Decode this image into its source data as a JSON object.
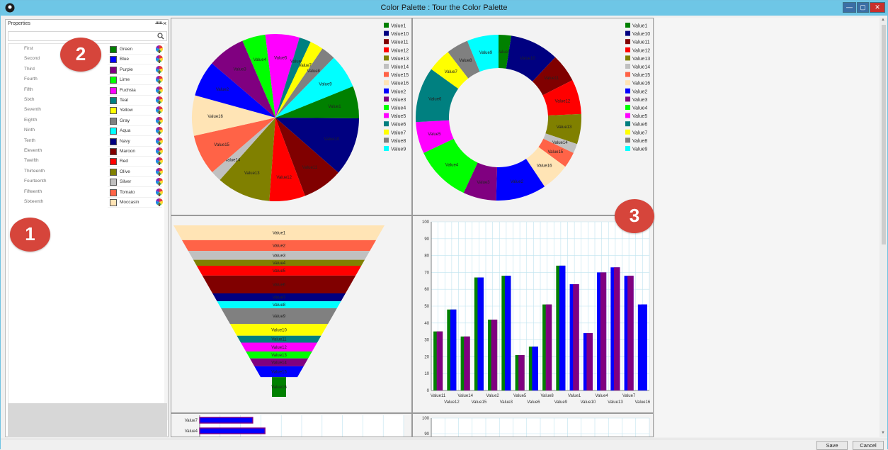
{
  "window": {
    "title": "Color Palette : Tour the Color Palette",
    "controls": [
      "—",
      "▢",
      "✕"
    ]
  },
  "properties": {
    "title": "Properties",
    "pin_label": "ᚊ",
    "close_label": "×",
    "rows": [
      {
        "name": "First",
        "color_name": "Green",
        "hex": "#008000"
      },
      {
        "name": "Second",
        "color_name": "Blue",
        "hex": "#0000FF"
      },
      {
        "name": "Third",
        "color_name": "Purple",
        "hex": "#800080"
      },
      {
        "name": "Fourth",
        "color_name": "Lime",
        "hex": "#00FF00"
      },
      {
        "name": "Fifth",
        "color_name": "Fuchsia",
        "hex": "#FF00FF"
      },
      {
        "name": "Sixth",
        "color_name": "Teal",
        "hex": "#008080"
      },
      {
        "name": "Seventh",
        "color_name": "Yellow",
        "hex": "#FFFF00"
      },
      {
        "name": "Eighth",
        "color_name": "Gray",
        "hex": "#808080"
      },
      {
        "name": "Ninth",
        "color_name": "Aqua",
        "hex": "#00FFFF"
      },
      {
        "name": "Tenth",
        "color_name": "Navy",
        "hex": "#000080"
      },
      {
        "name": "Eleventh",
        "color_name": "Maroon",
        "hex": "#800000"
      },
      {
        "name": "Twelfth",
        "color_name": "Red",
        "hex": "#FF0000"
      },
      {
        "name": "Thirteenth",
        "color_name": "Olive",
        "hex": "#808000"
      },
      {
        "name": "Fourteenth",
        "color_name": "Silver",
        "hex": "#C0C0C0"
      },
      {
        "name": "Fifteenth",
        "color_name": "Tomato",
        "hex": "#FF6347"
      },
      {
        "name": "Sixteenth",
        "color_name": "Moccasin",
        "hex": "#FFE4B5"
      }
    ]
  },
  "callouts": [
    "1",
    "2",
    "3"
  ],
  "buttons": {
    "save": "Save",
    "cancel": "Cancel"
  },
  "chart_data": [
    {
      "type": "pie",
      "legend_position": "right",
      "legend": [
        "Value1",
        "Value10",
        "Value11",
        "Value12",
        "Value13",
        "Value14",
        "Value15",
        "Value16",
        "Value2",
        "Value3",
        "Value4",
        "Value5",
        "Value6",
        "Value7",
        "Value8",
        "Value9"
      ],
      "slices": [
        {
          "label": "Value1",
          "value": 36,
          "color": "#008000"
        },
        {
          "label": "Value10",
          "value": 65,
          "color": "#000080"
        },
        {
          "label": "Value11",
          "value": 45,
          "color": "#800000"
        },
        {
          "label": "Value12",
          "value": 40,
          "color": "#FF0000"
        },
        {
          "label": "Value13",
          "value": 60,
          "color": "#808000"
        },
        {
          "label": "Value14",
          "value": 12,
          "color": "#C0C0C0"
        },
        {
          "label": "Value15",
          "value": 45,
          "color": "#FF6347"
        },
        {
          "label": "Value16",
          "value": 45,
          "color": "#FFE4B5"
        },
        {
          "label": "Value2",
          "value": 40,
          "color": "#0000FF"
        },
        {
          "label": "Value3",
          "value": 42,
          "color": "#800080"
        },
        {
          "label": "Value4",
          "value": 26,
          "color": "#00FF00"
        },
        {
          "label": "Value5",
          "value": 38,
          "color": "#FF00FF"
        },
        {
          "label": "Value6",
          "value": 13,
          "color": "#008080"
        },
        {
          "label": "Value7",
          "value": 15,
          "color": "#FFFF00"
        },
        {
          "label": "Value8",
          "value": 16,
          "color": "#808080"
        },
        {
          "label": "Value9",
          "value": 38,
          "color": "#00FFFF"
        }
      ]
    },
    {
      "type": "pie",
      "subtype": "doughnut",
      "legend_position": "right",
      "legend": [
        "Value1",
        "Value10",
        "Value11",
        "Value12",
        "Value13",
        "Value14",
        "Value15",
        "Value16",
        "Value2",
        "Value3",
        "Value4",
        "Value5",
        "Value6",
        "Value7",
        "Value8",
        "Value9"
      ],
      "slices": [
        {
          "label": "Value1",
          "value": 16,
          "color": "#008000"
        },
        {
          "label": "Value10",
          "value": 62,
          "color": "#000080"
        },
        {
          "label": "Value11",
          "value": 36,
          "color": "#800000"
        },
        {
          "label": "Value12",
          "value": 44,
          "color": "#FF0000"
        },
        {
          "label": "Value13",
          "value": 38,
          "color": "#808000"
        },
        {
          "label": "Value14",
          "value": 12,
          "color": "#C0C0C0"
        },
        {
          "label": "Value15",
          "value": 20,
          "color": "#FF6347"
        },
        {
          "label": "Value16",
          "value": 36,
          "color": "#FFE4B5"
        },
        {
          "label": "Value2",
          "value": 64,
          "color": "#0000FF"
        },
        {
          "label": "Value3",
          "value": 42,
          "color": "#800080"
        },
        {
          "label": "Value4",
          "value": 72,
          "color": "#00FF00"
        },
        {
          "label": "Value5",
          "value": 40,
          "color": "#FF00FF"
        },
        {
          "label": "Value6",
          "value": 70,
          "color": "#008080"
        },
        {
          "label": "Value7",
          "value": 30,
          "color": "#FFFF00"
        },
        {
          "label": "Value8",
          "value": 28,
          "color": "#808080"
        },
        {
          "label": "Value9",
          "value": 40,
          "color": "#00FFFF"
        }
      ]
    },
    {
      "type": "funnel",
      "segments": [
        {
          "label": "Value1",
          "value": 75,
          "color": "#FFE4B5"
        },
        {
          "label": "Value2",
          "value": 55,
          "color": "#FF6347"
        },
        {
          "label": "Value3",
          "value": 45,
          "color": "#C0C0C0"
        },
        {
          "label": "Value4",
          "value": 30,
          "color": "#808000"
        },
        {
          "label": "Value5",
          "value": 50,
          "color": "#FF0000"
        },
        {
          "label": "Value6",
          "value": 90,
          "color": "#800000"
        },
        {
          "label": "Value7",
          "value": 40,
          "color": "#000080"
        },
        {
          "label": "Value8",
          "value": 35,
          "color": "#00FFFF"
        },
        {
          "label": "Value9",
          "value": 80,
          "color": "#808080"
        },
        {
          "label": "Value10",
          "value": 60,
          "color": "#FFFF00"
        },
        {
          "label": "Value11",
          "value": 35,
          "color": "#008080"
        },
        {
          "label": "Value12",
          "value": 45,
          "color": "#FF00FF"
        },
        {
          "label": "Value13",
          "value": 35,
          "color": "#00FF00"
        },
        {
          "label": "Value14",
          "value": 40,
          "color": "#800080"
        },
        {
          "label": "Value15",
          "value": 55,
          "color": "#0000FF"
        },
        {
          "label": "Value16",
          "value": 100,
          "color": "#008000"
        }
      ]
    },
    {
      "type": "bar",
      "ylim": [
        0,
        100
      ],
      "yticks": [
        0,
        10,
        20,
        30,
        40,
        50,
        60,
        70,
        80,
        90,
        100
      ],
      "grid": true,
      "x_labels_row1": [
        "Value11",
        "Value14",
        "Value2",
        "Value5",
        "Value8",
        "Value1",
        "Value4",
        "Value7"
      ],
      "x_labels_row2": [
        "Value12",
        "Value15",
        "Value3",
        "Value6",
        "Value9",
        "Value10",
        "Value13",
        "Value16"
      ],
      "bars": [
        {
          "value": 35,
          "color": "#008000",
          "edge": "#800080"
        },
        {
          "value": 48,
          "color": "#008000",
          "edge": "#0000FF"
        },
        {
          "value": 32,
          "color": "#008000",
          "edge": "#800080"
        },
        {
          "value": 67,
          "color": "#008000",
          "edge": "#0000FF"
        },
        {
          "value": 42,
          "color": "#008000",
          "edge": "#800080"
        },
        {
          "value": 68,
          "color": "#008000",
          "edge": "#0000FF"
        },
        {
          "value": 21,
          "color": "#008000",
          "edge": "#800080"
        },
        {
          "value": 26,
          "color": "#008000",
          "edge": "#0000FF"
        },
        {
          "value": 51,
          "color": "#008000",
          "edge": "#800080"
        },
        {
          "value": 74,
          "color": "#008000",
          "edge": "#0000FF"
        },
        {
          "value": 63,
          "color": "#0000FF",
          "edge": "#800080"
        },
        {
          "value": 34,
          "color": "#0000FF",
          "edge": "#800080"
        },
        {
          "value": 70,
          "color": "#0000FF",
          "edge": "#800080"
        },
        {
          "value": 73,
          "color": "#0000FF",
          "edge": "#800080"
        },
        {
          "value": 68,
          "color": "#0000FF",
          "edge": "#800080"
        },
        {
          "value": 51,
          "color": "#0000FF",
          "edge": "#0000FF"
        }
      ]
    },
    {
      "type": "bar",
      "orientation": "horizontal",
      "categories": [
        "Value7",
        "Value4"
      ],
      "values": [
        26,
        32
      ]
    },
    {
      "type": "bar",
      "yticks": [
        100,
        90
      ]
    }
  ]
}
